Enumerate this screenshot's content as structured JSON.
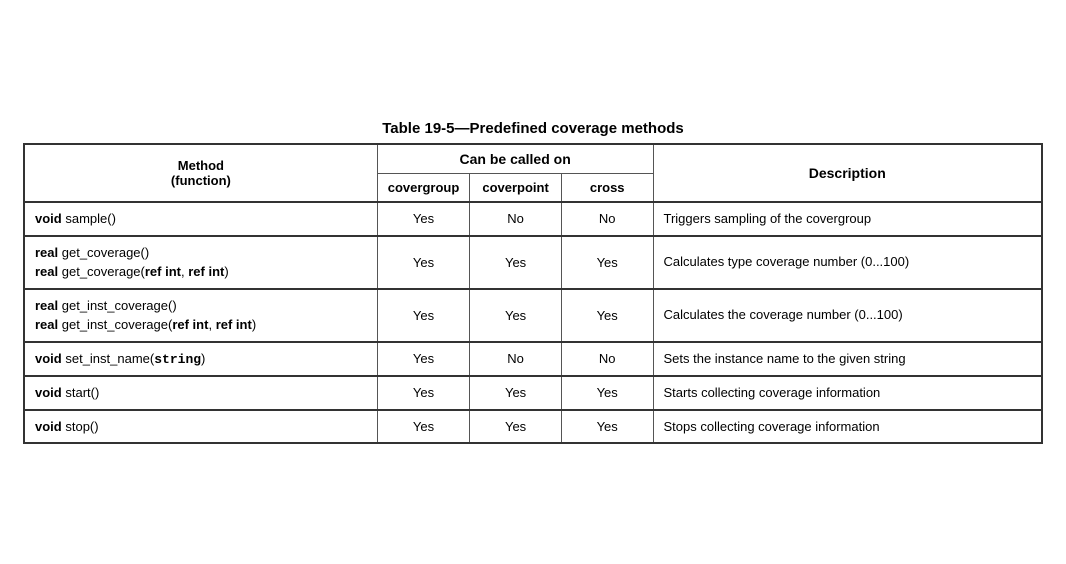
{
  "title": "Table 19-5—Predefined coverage methods",
  "columns": {
    "method": "Method\n(function)",
    "can_be_called_on": "Can be called on",
    "covergroup": "covergroup",
    "coverpoint": "coverpoint",
    "cross": "cross",
    "description": "Description"
  },
  "rows": [
    {
      "method_html": "<span class='kw'>void</span> sample()",
      "covergroup": "Yes",
      "coverpoint": "No",
      "cross": "No",
      "description": "Triggers sampling of the covergroup"
    },
    {
      "method_html": "<span class='kw'>real</span> get_coverage()<br><span class='kw'>real</span> get_coverage(<span class='kw'>ref int</span>, <span class='kw'>ref int</span>)",
      "covergroup": "Yes",
      "coverpoint": "Yes",
      "cross": "Yes",
      "description": "Calculates type coverage number (0...100)"
    },
    {
      "method_html": "<span class='kw'>real</span> get_inst_coverage()<br><span class='kw'>real</span> get_inst_coverage(<span class='kw'>ref int</span>, <span class='kw'>ref int</span>)",
      "covergroup": "Yes",
      "coverpoint": "Yes",
      "cross": "Yes",
      "description": "Calculates the coverage number (0...100)"
    },
    {
      "method_html": "<span class='kw'>void</span> set_inst_name(<span class='bold-code'>string</span>)",
      "covergroup": "Yes",
      "coverpoint": "No",
      "cross": "No",
      "description": "Sets the instance name to the given string"
    },
    {
      "method_html": "<span class='kw'>void</span> start()",
      "covergroup": "Yes",
      "coverpoint": "Yes",
      "cross": "Yes",
      "description": "Starts collecting coverage information"
    },
    {
      "method_html": "<span class='kw'>void</span> stop()",
      "covergroup": "Yes",
      "coverpoint": "Yes",
      "cross": "Yes",
      "description": "Stops collecting coverage information"
    }
  ]
}
